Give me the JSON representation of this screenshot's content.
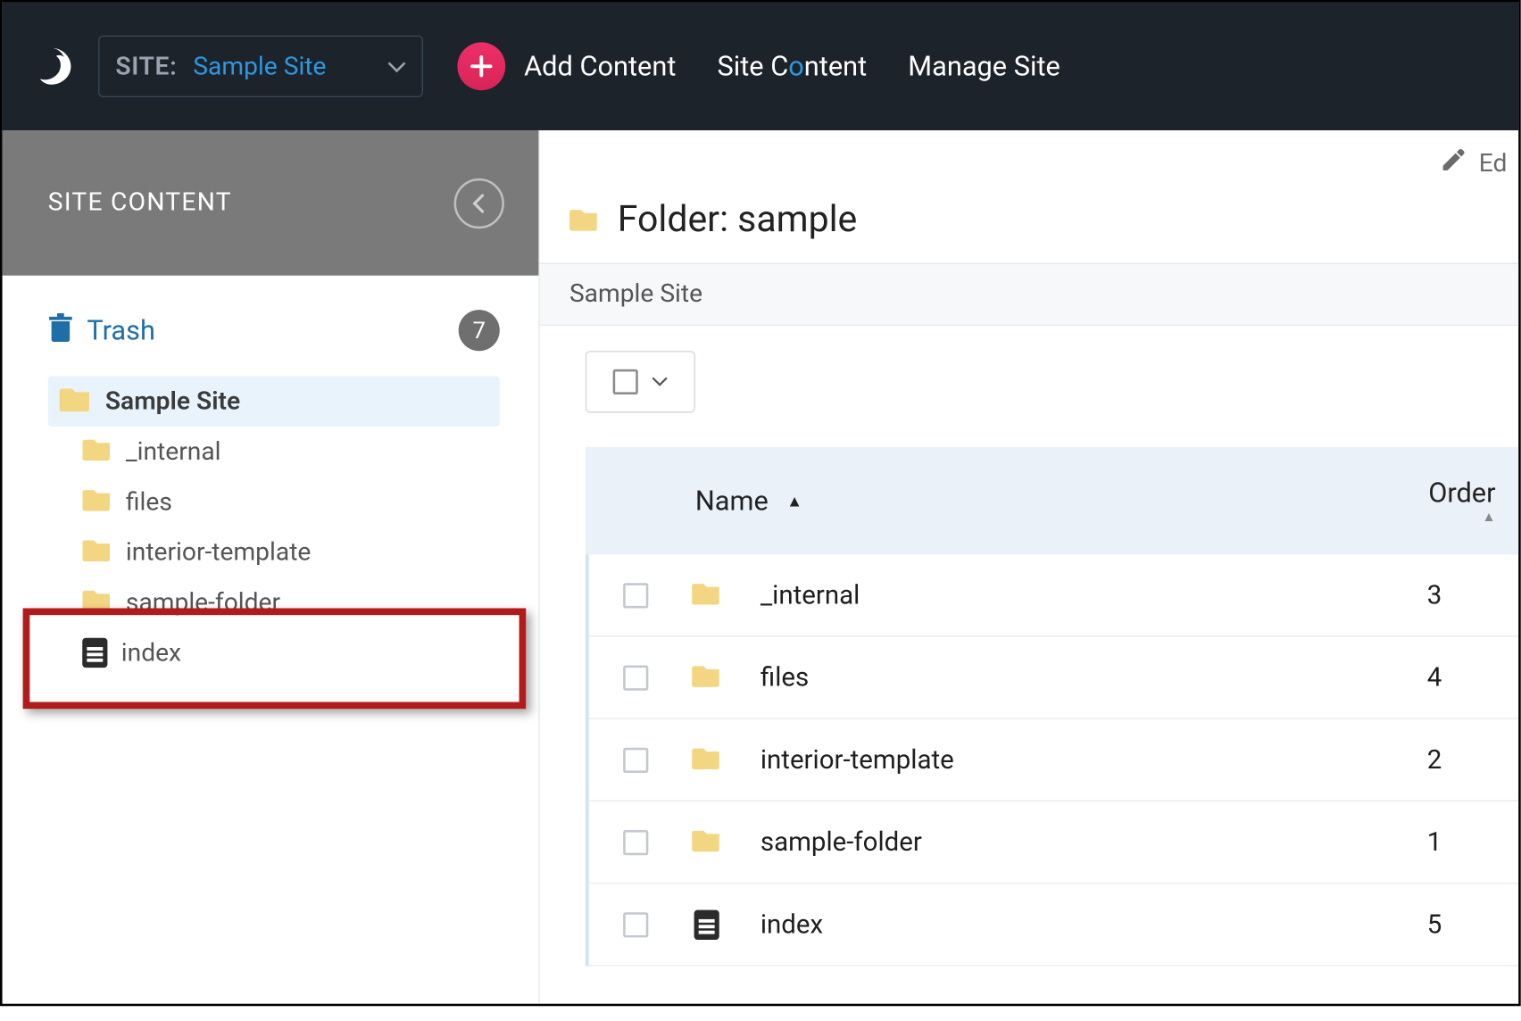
{
  "topbar": {
    "site_label": "SITE:",
    "site_value": "Sample Site",
    "add_label": "Add Content",
    "nav_site_content_pre": "Site C",
    "nav_site_content_accent": "o",
    "nav_site_content_post": "ntent",
    "nav_manage": "Manage Site"
  },
  "sidebar": {
    "title": "SITE CONTENT",
    "trash_label": "Trash",
    "trash_count": "7",
    "root_label": "Sample Site",
    "items": [
      {
        "label": "_internal",
        "type": "folder"
      },
      {
        "label": "files",
        "type": "folder"
      },
      {
        "label": "interior-template",
        "type": "folder"
      },
      {
        "label": "sample-folder",
        "type": "folder"
      },
      {
        "label": "index",
        "type": "page"
      }
    ]
  },
  "main": {
    "edit_label": "Ed",
    "folder_prefix": "Folder: ",
    "folder_name": "sample",
    "breadcrumb": "Sample Site",
    "headers": {
      "name": "Name",
      "order": "Order"
    },
    "rows": [
      {
        "name": "_internal",
        "type": "folder",
        "order": "3"
      },
      {
        "name": "files",
        "type": "folder",
        "order": "4"
      },
      {
        "name": "interior-template",
        "type": "folder",
        "order": "2"
      },
      {
        "name": "sample-folder",
        "type": "folder",
        "order": "1"
      },
      {
        "name": "index",
        "type": "page",
        "order": "5"
      }
    ]
  }
}
